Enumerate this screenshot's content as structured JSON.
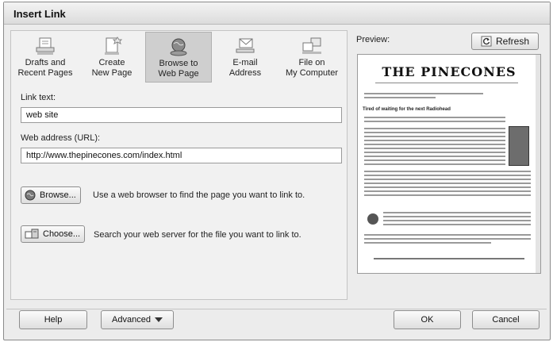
{
  "dialog": {
    "title": "Insert Link"
  },
  "toolbar": {
    "items": [
      {
        "id": "drafts",
        "label": "Drafts and\nRecent Pages",
        "icon": "drafts-icon"
      },
      {
        "id": "create",
        "label": "Create\nNew Page",
        "icon": "new-page-icon"
      },
      {
        "id": "browse",
        "label": "Browse to\nWeb Page",
        "icon": "globe-icon",
        "selected": true
      },
      {
        "id": "email",
        "label": "E-mail\nAddress",
        "icon": "envelope-icon"
      },
      {
        "id": "file",
        "label": "File on\nMy Computer",
        "icon": "computer-icon"
      }
    ]
  },
  "link_text": {
    "label": "Link text:",
    "value": "web site"
  },
  "web_address": {
    "label": "Web address (URL):",
    "value": "http://www.thepinecones.com/index.html"
  },
  "browse": {
    "button_label": "Browse...",
    "description": "Use a web browser to find the page you want to link to."
  },
  "choose": {
    "button_label": "Choose...",
    "description": "Search your web server for the file you want to link to."
  },
  "preview": {
    "label": "Preview:",
    "refresh_label": "Refresh",
    "site_title": "THE PINECONES",
    "headline": "Tired of waiting for the next Radiohead"
  },
  "footer": {
    "help_label": "Help",
    "advanced_label": "Advanced",
    "ok_label": "OK",
    "cancel_label": "Cancel"
  }
}
